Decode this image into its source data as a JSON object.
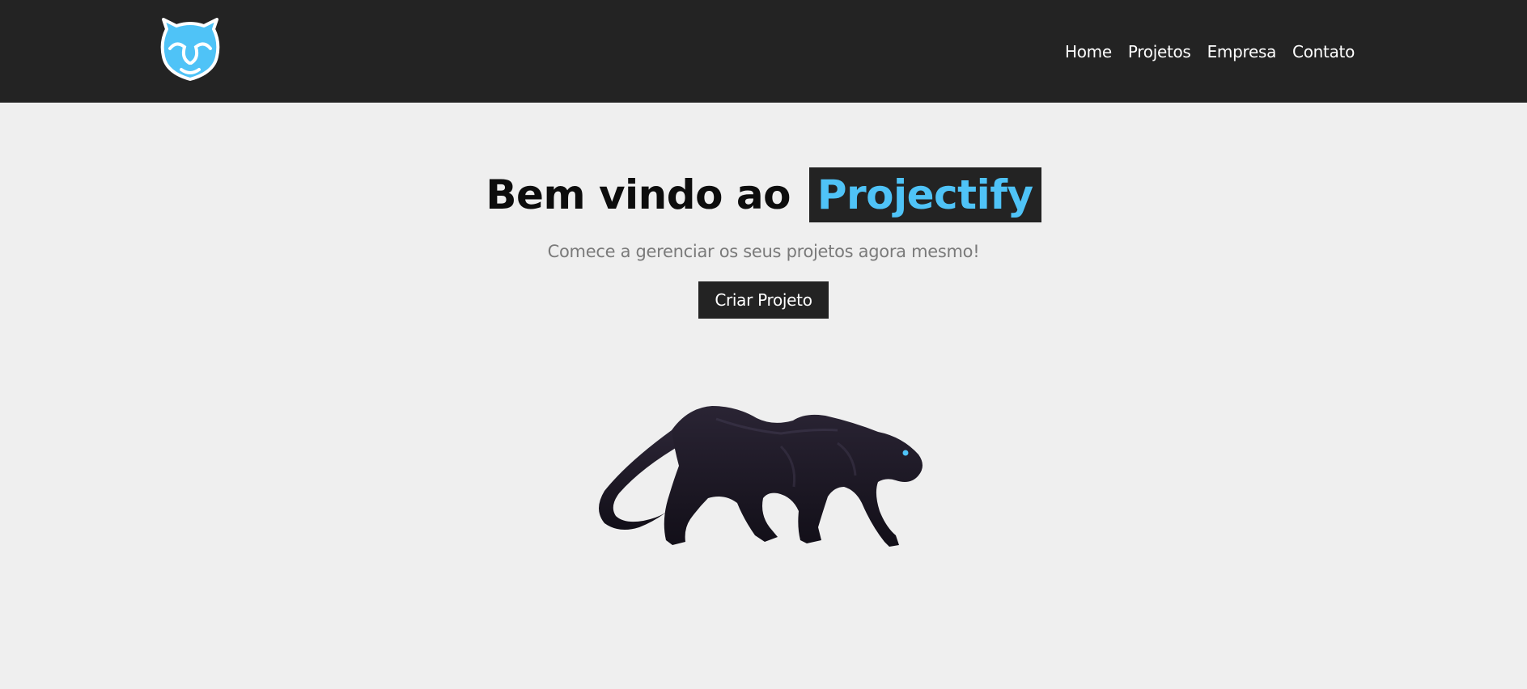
{
  "header": {
    "logo_icon": "panther-head-icon",
    "nav": [
      {
        "label": "Home"
      },
      {
        "label": "Projetos"
      },
      {
        "label": "Empresa"
      },
      {
        "label": "Contato"
      }
    ]
  },
  "hero": {
    "title_prefix": "Bem vindo ao",
    "brand": "Projectify",
    "subtitle": "Comece a gerenciar os seus projetos agora mesmo!",
    "cta_label": "Criar Projeto",
    "illustration": "panther-illustration"
  },
  "colors": {
    "nav_bg": "#232323",
    "page_bg": "#efefef",
    "accent": "#4fc3f7"
  }
}
